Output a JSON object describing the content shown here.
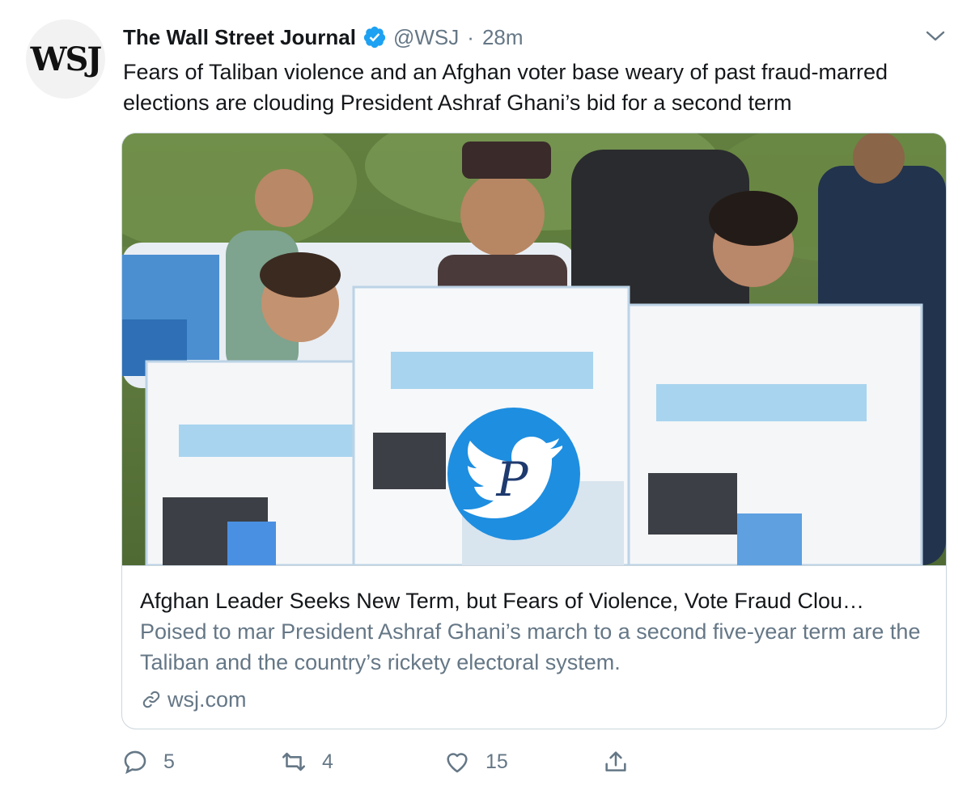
{
  "author": {
    "avatar_text": "WSJ",
    "display_name": "The Wall Street Journal",
    "verified_icon": "verified-badge-icon",
    "handle": "@WSJ",
    "separator": "·",
    "time": "28m"
  },
  "tweet": {
    "text": "Fears of Taliban violence and an Afghan voter base weary of past fraud-marred elections are clouding President Ashraf Ghani’s bid for a second term"
  },
  "card": {
    "image_description": "photo",
    "watermark_letter": "P",
    "title": "Afghan Leader Seeks New Term, but Fears of Violence, Vote Fraud Clou…",
    "description": "Poised to mar President Ashraf Ghani’s march to a second five-year term are the Taliban and the country’s rickety electoral system.",
    "domain": "wsj.com"
  },
  "actions": {
    "reply_count": "5",
    "retweet_count": "4",
    "like_count": "15"
  },
  "colors": {
    "text_primary": "#14171a",
    "text_secondary": "#657786",
    "verified_blue": "#1da1f2",
    "border": "#ccd6dd"
  }
}
